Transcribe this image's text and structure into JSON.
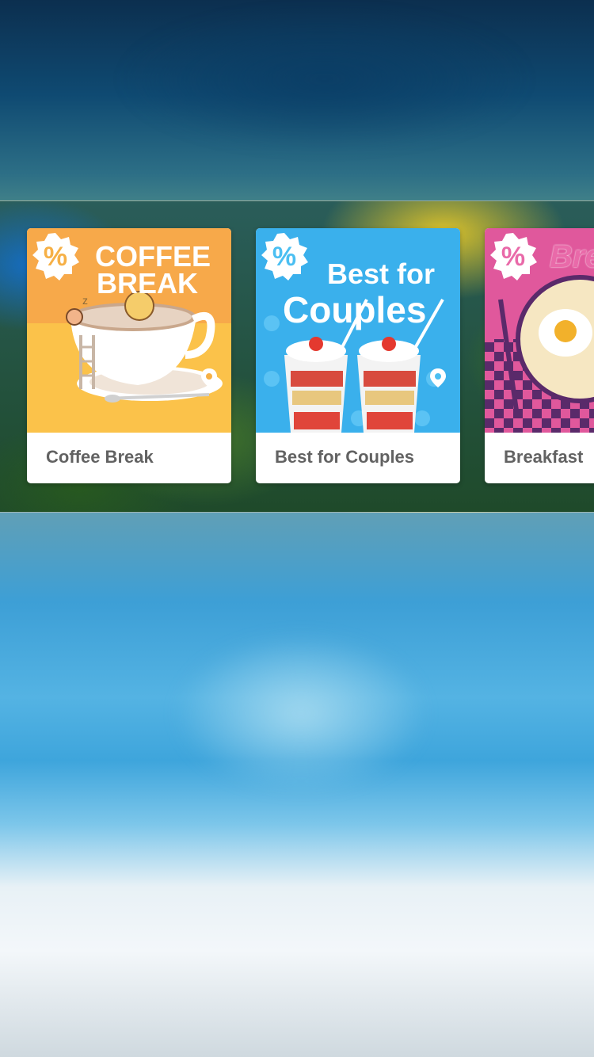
{
  "cards": [
    {
      "title": "Coffee Break",
      "art_text": [
        "COFFEE",
        "BREAK"
      ],
      "badge_symbol": "%",
      "colors": {
        "art_bg": "#f7a94a",
        "accent": "#f6b046"
      }
    },
    {
      "title": "Best for Couples",
      "art_text": [
        "Best for",
        "Couples"
      ],
      "badge_symbol": "%",
      "colors": {
        "art_bg": "#3ab0ec",
        "accent": "#4bbff2"
      }
    },
    {
      "title": "Breakfast",
      "art_text": [
        "Bre"
      ],
      "badge_symbol": "%",
      "colors": {
        "art_bg": "#e0589c",
        "accent": "#e96aa9"
      }
    }
  ],
  "icons": {
    "badge": "percent-badge-icon",
    "pin": "location-pin-icon"
  }
}
